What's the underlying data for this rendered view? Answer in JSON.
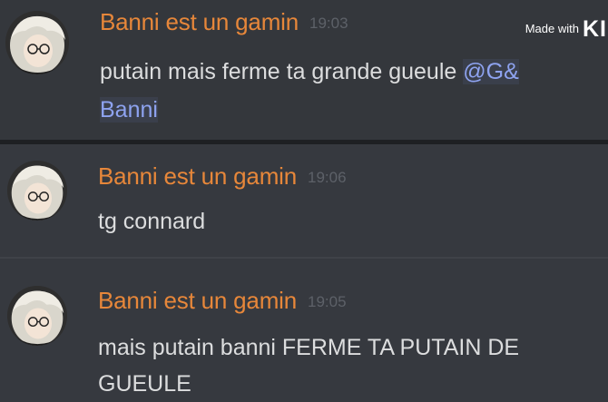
{
  "messages": [
    {
      "username": "Banni est un gamin",
      "timestamp": "19:03",
      "text": "putain mais ferme ta grande gueule",
      "mention_1": "@G&",
      "mention_2": "Banni"
    },
    {
      "username": "Banni est un gamin",
      "timestamp": "19:06",
      "text": "tg connard"
    },
    {
      "username": "Banni est un gamin",
      "timestamp": "19:05",
      "text": "mais putain banni FERME TA PUTAIN DE GUEULE"
    }
  ],
  "watermark": {
    "prefix": "Made with",
    "brand": "KIN"
  },
  "colors": {
    "background": "#36393f",
    "username": "#e7873a",
    "mention": "#8ea3f0",
    "text": "#dcddde",
    "timestamp": "#5d6168"
  },
  "icons": {
    "avatar": "anime-avatar-icon"
  }
}
